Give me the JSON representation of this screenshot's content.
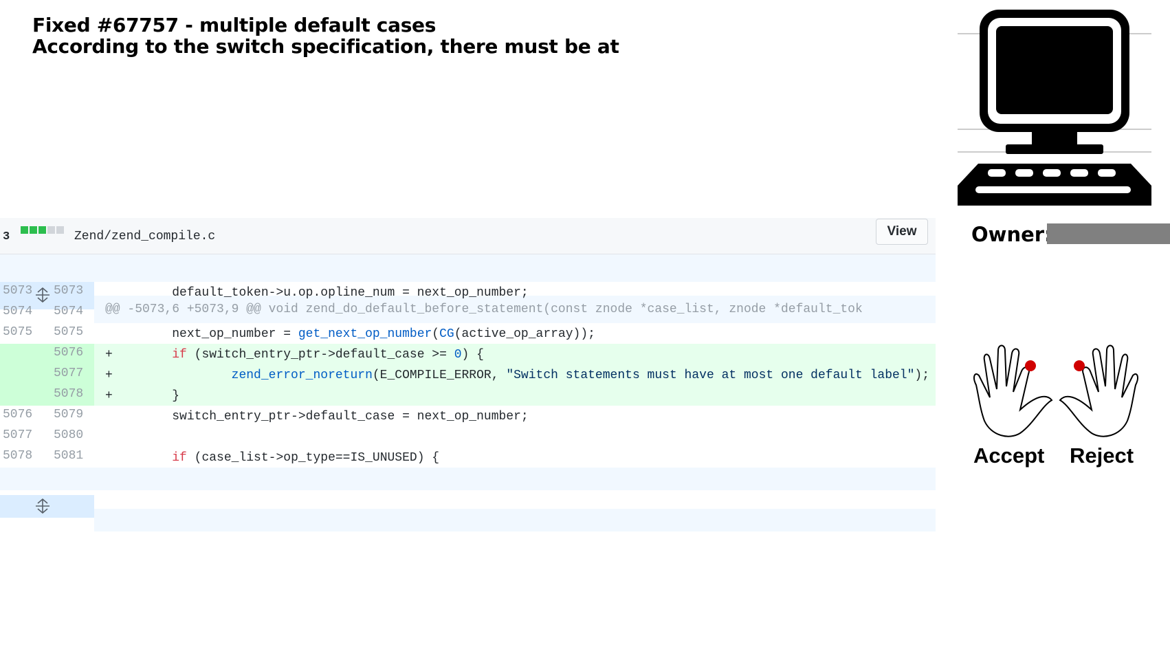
{
  "title": {
    "line1": "Fixed #67757 - multiple default cases",
    "line2": "According to the switch specification, there must be at"
  },
  "owner": {
    "label": "Owner:"
  },
  "actions": {
    "accept_label": "Accept",
    "reject_label": "Reject"
  },
  "file": {
    "change_count": "3",
    "name": "Zend/zend_compile.c",
    "view_label": "View"
  },
  "hunk_header": "@@ -5073,6 +5073,9 @@ void zend_do_default_before_statement(const znode *case_list, znode *default_tok",
  "rows": [
    {
      "old": "5073",
      "new": "5073",
      "sign": " ",
      "code": "        default_token->u.op.opline_num = next_op_number;"
    },
    {
      "old": "5074",
      "new": "5074",
      "sign": " ",
      "code": ""
    },
    {
      "old": "5075",
      "new": "5075",
      "sign": " ",
      "code_a": "        next_op_number = ",
      "code_fn": "get_next_op_number",
      "code_b": "(",
      "code_fn2": "CG",
      "code_c": "(active_op_array));"
    },
    {
      "old": "",
      "new": "5076",
      "sign": "+",
      "code_kw": "if",
      "code_a": " (switch_entry_ptr->default_case >= ",
      "code_num": "0",
      "code_b": ") {"
    },
    {
      "old": "",
      "new": "5077",
      "sign": "+",
      "code_fn": "zend_error_noreturn",
      "code_a": "(E_COMPILE_ERROR, ",
      "code_str": "\"Switch statements must have at most one default label\"",
      "code_b": ");"
    },
    {
      "old": "",
      "new": "5078",
      "sign": "+",
      "code": "        }"
    },
    {
      "old": "5076",
      "new": "5079",
      "sign": " ",
      "code": "        switch_entry_ptr->default_case = next_op_number;"
    },
    {
      "old": "5077",
      "new": "5080",
      "sign": " ",
      "code": ""
    },
    {
      "old": "5078",
      "new": "5081",
      "sign": " ",
      "code_kw": "if",
      "code_a": " (case_list->op_type==IS_UNUSED) {"
    }
  ]
}
